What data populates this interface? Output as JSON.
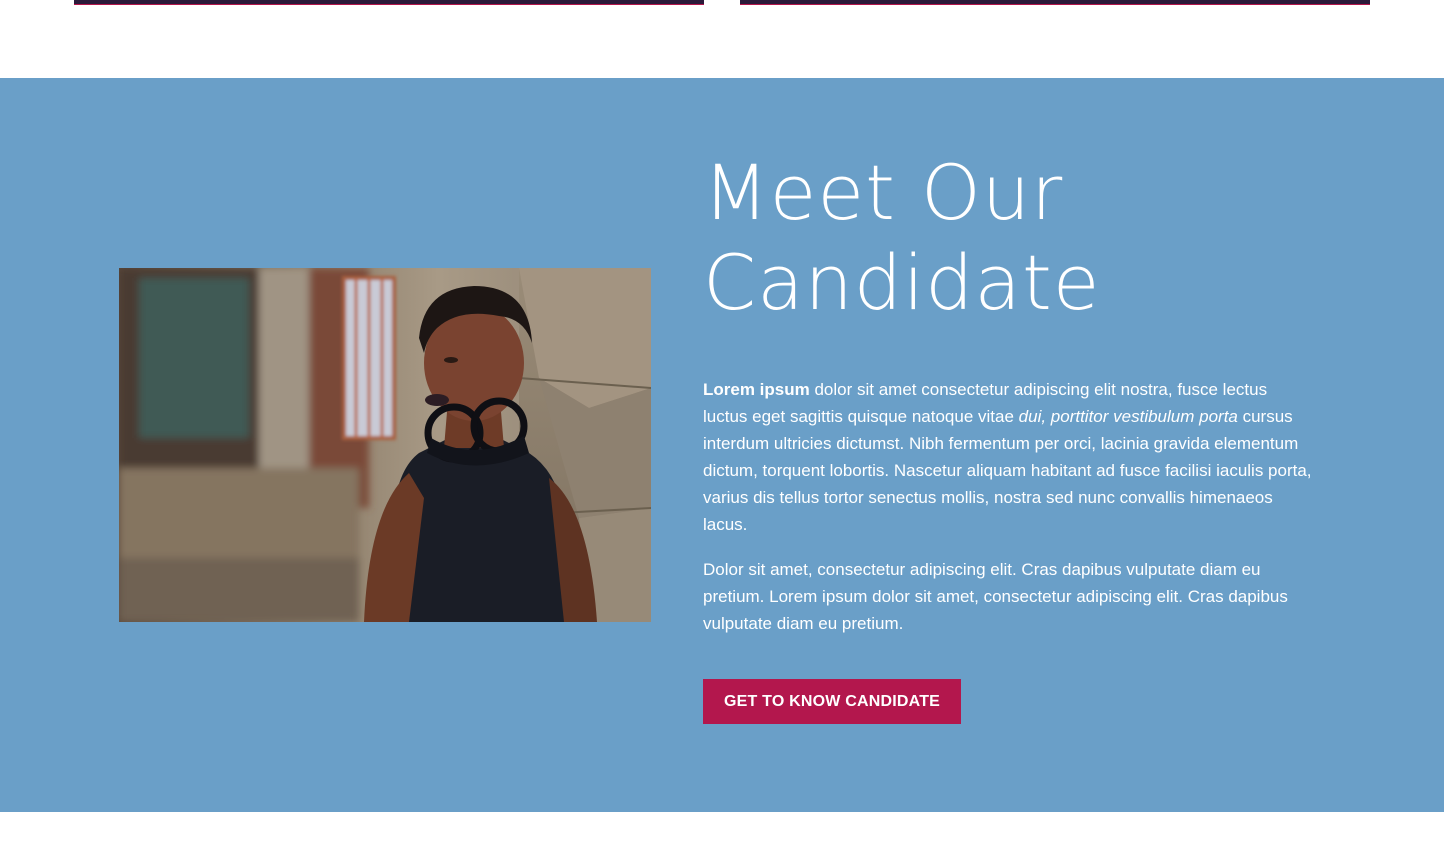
{
  "section": {
    "background": "#6a9fc8",
    "heading_line1": "Meet Our",
    "heading_line2": "Candidate",
    "paragraph1": {
      "bold": "Lorem ipsum",
      "part1": " dolor sit amet consectetur adipiscing elit nostra, fusce lectus luctus eget sagittis quisque natoque vitae ",
      "italic": "dui, porttitor vestibulum porta",
      "part2": " cursus interdum ultricies dictumst. Nibh fermentum per orci, lacinia gravida elementum dictum, torquent lobortis. Nascetur aliquam habitant ad fusce facilisi iaculis porta, varius dis tellus tortor senectus mollis, nostra sed nunc convallis himenaeos lacus."
    },
    "paragraph2": "Dolor sit amet, consectetur adipiscing elit. Cras dapibus vulputate diam eu pretium. Lorem ipsum dolor sit amet, consectetur adipiscing elit. Cras dapibus vulputate diam eu pretium.",
    "cta_label": "GET TO KNOW CANDIDATE",
    "cta_color": "#b3174d"
  }
}
